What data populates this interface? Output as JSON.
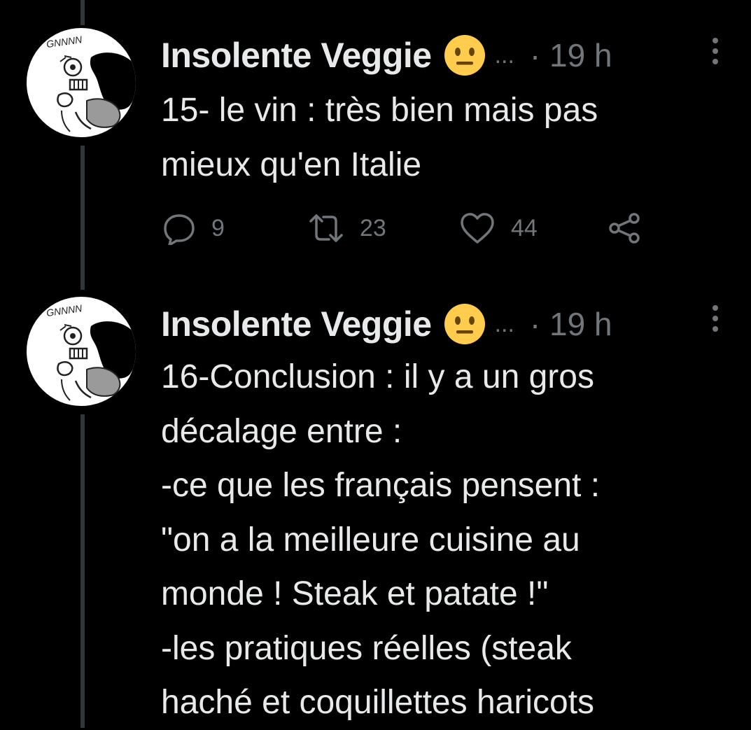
{
  "tweets": [
    {
      "author_name": "Insolente Veggie",
      "avatar_text": "GNNNN",
      "status_emoji": "neutral-face-emoji",
      "ellipsis": "...",
      "time": "· 19 h",
      "text": "15- le vin : très bien mais pas\nmieux qu'en Italie",
      "actions": {
        "reply_count": "9",
        "retweet_count": "23",
        "like_count": "44"
      }
    },
    {
      "author_name": "Insolente Veggie",
      "avatar_text": "GNNNN",
      "status_emoji": "neutral-face-emoji",
      "ellipsis": "...",
      "time": "· 19 h",
      "text": "16-Conclusion : il y a un gros\ndécalage entre :\n-ce que les français pensent :\n\"on a la meilleure cuisine au\nmonde ! Steak et patate !\"\n-les pratiques réelles (steak\nhaché et coquillettes haricots"
    }
  ],
  "colors": {
    "background": "#000000",
    "text": "#e7e9ea",
    "secondary": "#71767b",
    "thread_line": "#333639",
    "emoji": "#ffcc4d"
  }
}
